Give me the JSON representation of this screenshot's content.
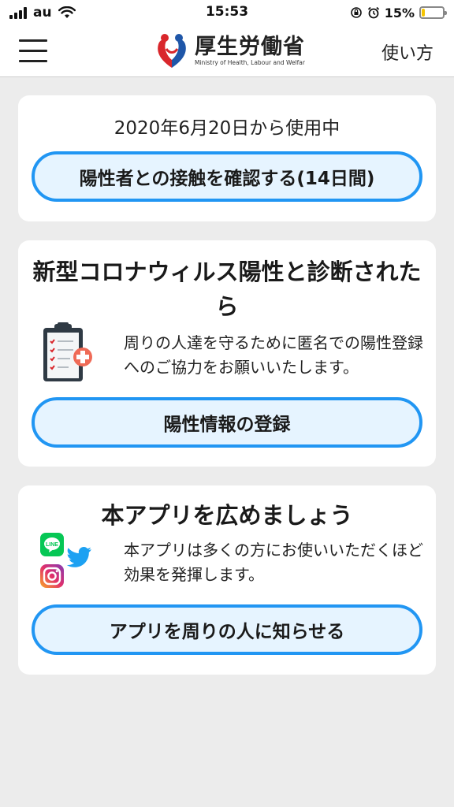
{
  "status_bar": {
    "carrier": "au",
    "time": "15:53",
    "battery_percent": "15%",
    "battery_level": 0.15,
    "battery_color": "#f5c400"
  },
  "nav": {
    "menu_icon": "hamburger-icon",
    "logo": {
      "title": "厚生労働省",
      "subtitle": "Ministry of Health, Labour and Welfar"
    },
    "help_link": "使い方"
  },
  "usage_card": {
    "status_text": "2020年6月20日から使用中",
    "check_button": "陽性者との接触を確認する(14日間)"
  },
  "positive_card": {
    "title": "新型コロナウィルス陽性と診断されたら",
    "icon": "clipboard-medical-icon",
    "description": "周りの人達を守るために匿名での陽性登録へのご協力をお願いいたします。",
    "register_button": "陽性情報の登録"
  },
  "share_card": {
    "title": "本アプリを広めましょう",
    "icons": [
      "line-icon",
      "twitter-icon",
      "instagram-icon"
    ],
    "description": "本アプリは多くの方にお使いいただくほど効果を発揮します。",
    "share_button": "アプリを周りの人に知らせる"
  },
  "colors": {
    "accent": "#2196f3",
    "button_fill": "#e6f4ff",
    "background": "#ececec",
    "card": "#ffffff"
  }
}
